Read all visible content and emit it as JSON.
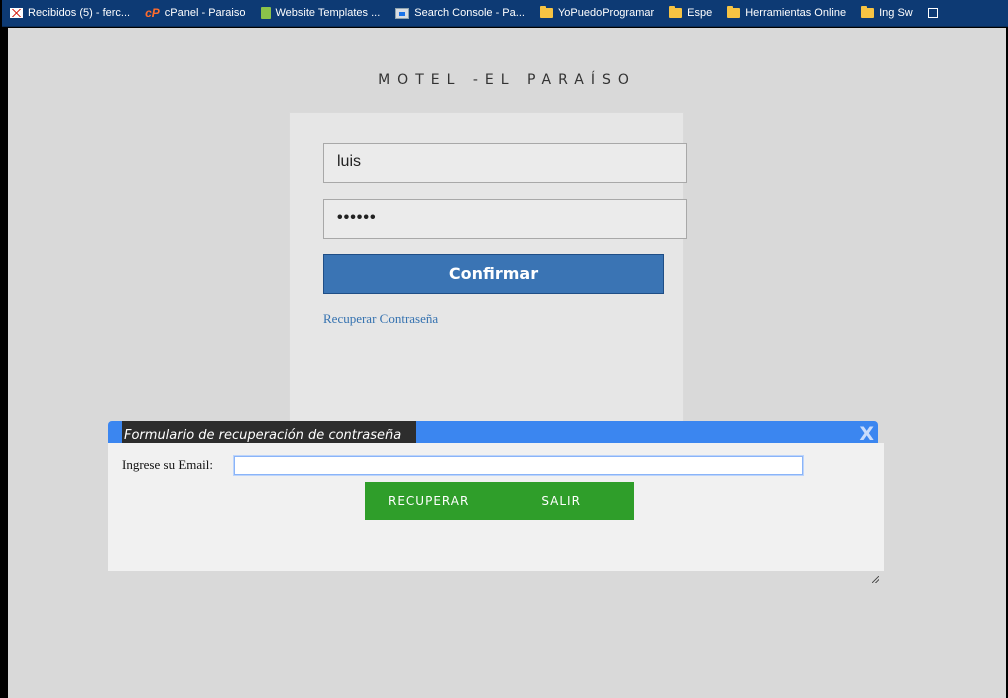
{
  "bookmarks": [
    {
      "label": "Recibidos (5) - ferc...",
      "icon": "gmail-icon"
    },
    {
      "label": "cPanel - Paraiso",
      "icon": "cpanel-icon"
    },
    {
      "label": "Website Templates ...",
      "icon": "template-icon"
    },
    {
      "label": "Search Console - Pa...",
      "icon": "search-console-icon"
    },
    {
      "label": "YoPuedoProgramar",
      "icon": "folder-icon"
    },
    {
      "label": "Espe",
      "icon": "folder-icon"
    },
    {
      "label": "Herramientas Online",
      "icon": "folder-icon"
    },
    {
      "label": "Ing Sw",
      "icon": "folder-icon"
    }
  ],
  "site": {
    "title": "MOTEL -EL PARAÍSO"
  },
  "login": {
    "username_value": "luis",
    "password_value": "••••••",
    "confirm_label": "Confirmar",
    "recover_link": "Recuperar Contraseña"
  },
  "dialog": {
    "title": "Formulario de recuperación de contraseña",
    "close_label": "X",
    "email_label": "Ingrese su Email:",
    "email_value": "",
    "recover_label": "RECUPERAR",
    "exit_label": "SALIR"
  },
  "colors": {
    "bookmarks_bar": "#0d3a74",
    "page_bg": "#d9d9d9",
    "confirm_button": "#3a74b4",
    "dialog_titlebar": "#3b86f0",
    "dialog_buttons": "#2f9e2a"
  }
}
